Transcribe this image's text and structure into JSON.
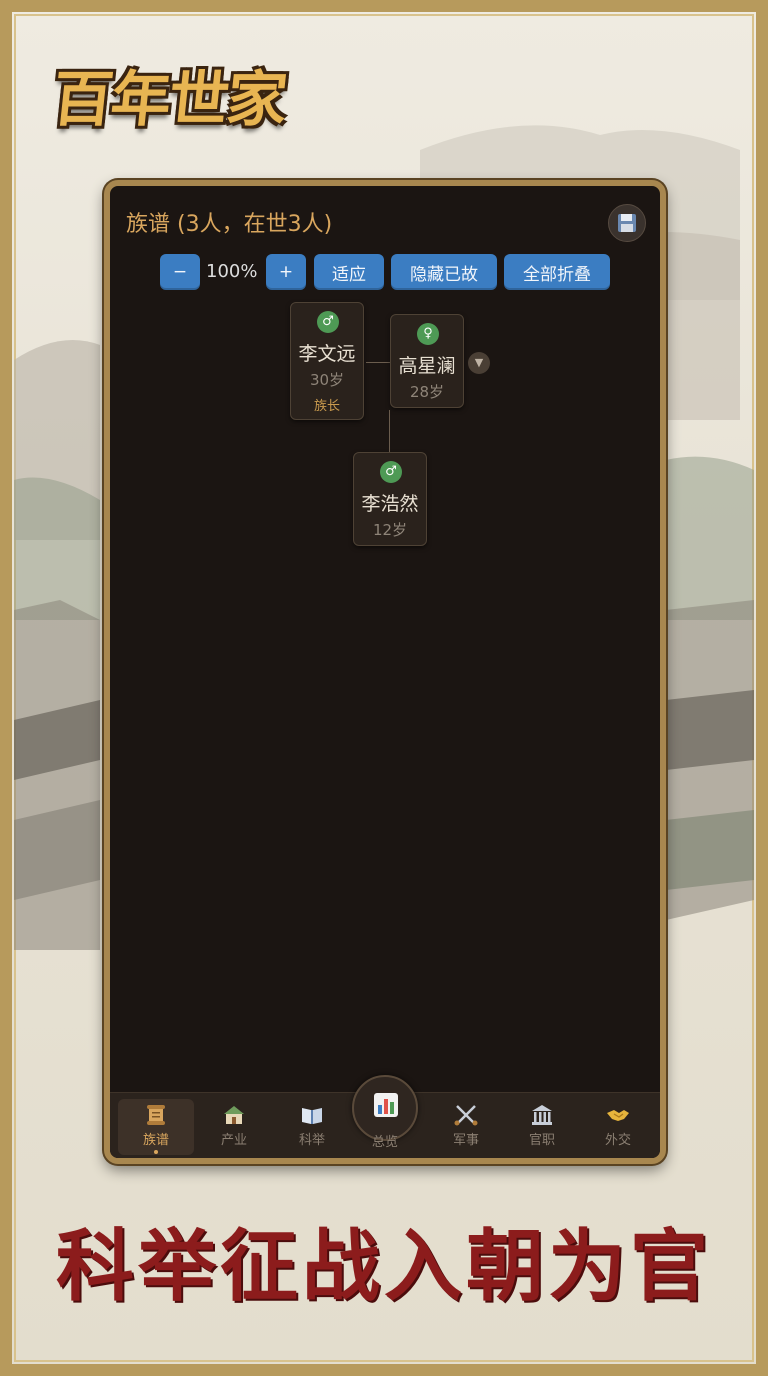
{
  "app": {
    "logo_text": "百年世家",
    "slogan": "科举征战入朝为官"
  },
  "colors": {
    "accent_gold": "#d9a65e",
    "button_blue": "#3b7dc2",
    "panel_bg": "#1b1512",
    "male_green": "#4e9a55",
    "slogan_red": "#8c1c1c"
  },
  "panel": {
    "title": "族谱 (3人，在世3人)",
    "save_icon": "floppy-disk-icon",
    "toolbar": {
      "zoom_out": "−",
      "zoom_value": "100%",
      "zoom_in": "+",
      "fit": "适应",
      "hide_dead": "隐藏已故",
      "collapse_all": "全部折叠"
    }
  },
  "family": [
    {
      "name": "李文远",
      "age": "30岁",
      "role": "族长",
      "gender": "male"
    },
    {
      "name": "高星澜",
      "age": "28岁",
      "role": "",
      "gender": "female"
    },
    {
      "name": "李浩然",
      "age": "12岁",
      "role": "",
      "gender": "male"
    }
  ],
  "nav": {
    "items": [
      {
        "label": "族谱",
        "icon": "scroll-icon",
        "active": true
      },
      {
        "label": "产业",
        "icon": "house-icon",
        "active": false
      },
      {
        "label": "科举",
        "icon": "book-icon",
        "active": false
      },
      {
        "label": "总览",
        "icon": "bar-chart-icon",
        "active": false
      },
      {
        "label": "军事",
        "icon": "crossed-swords-icon",
        "active": false
      },
      {
        "label": "官职",
        "icon": "government-building-icon",
        "active": false
      },
      {
        "label": "外交",
        "icon": "handshake-icon",
        "active": false
      }
    ]
  }
}
